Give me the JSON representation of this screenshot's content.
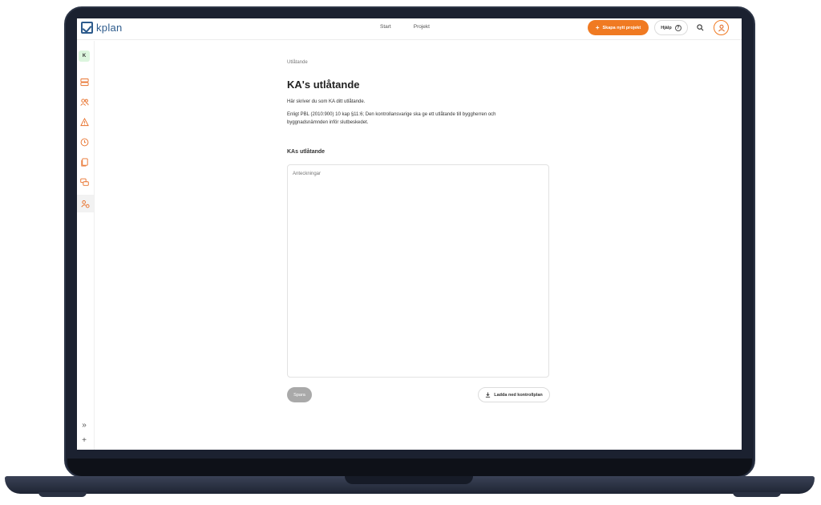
{
  "app": {
    "logo_text": "kplan",
    "brand_color": "#2d5b8c",
    "accent_color": "#f07a22"
  },
  "nav": {
    "items": [
      {
        "label": "Start"
      },
      {
        "label": "Projekt"
      }
    ]
  },
  "header": {
    "new_project_label": "Skapa nytt projekt",
    "help_label": "Hjälp",
    "help_icon": "?"
  },
  "sidebar": {
    "avatar_letter": "K",
    "icons": [
      "layers-icon",
      "users-icon",
      "warning-icon",
      "clock-icon",
      "documents-icon",
      "chat-icon",
      "person-settings-icon"
    ],
    "collapse_glyph": "»",
    "add_glyph": "+"
  },
  "main": {
    "breadcrumb": "Utlåtande",
    "title": "KA's utlåtande",
    "intro": "Här skriver du som KA ditt utlåtande.",
    "law_text": "Enligt PBL (2010:900) 10 kap §11:6; Den kontrollansvarige ska ge ett utlåtande till byggherren och byggnadsnämnden inför slutbeskedet.",
    "section_label": "KAs utlåtande",
    "notes_placeholder": "Anteckningar",
    "save_label": "Spara",
    "download_label": "Ladda ned kontrollplan"
  }
}
